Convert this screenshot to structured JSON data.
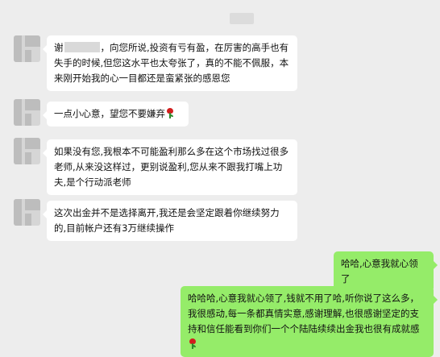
{
  "chat": {
    "messages": [
      {
        "side": "left",
        "parts": [
          "谢",
          "，向您所说,投资有亏有盈，在厉害的高手也有失手的时候,但您这水平也太夸张了，真的不能不佩服，本来刚开始我的心一目都还是蛮紧张的感恩您"
        ]
      },
      {
        "side": "left",
        "text": "一点小心意，望您不要嫌弃",
        "emoji": "rose-icon"
      },
      {
        "side": "left",
        "text": "如果没有您,我根本不可能盈利那么多在这个市场找过很多老师,从来没这样过，更别说盈利,您从来不跟我打嘴上功夫,是个行动派老师"
      },
      {
        "side": "left",
        "text": "这次出金并不是选择离开,我还是会坚定跟着你继续努力的,目前帐户还有3万继续操作"
      },
      {
        "side": "right",
        "text": "哈哈,心意我就心领了"
      },
      {
        "side": "right",
        "text": "哈哈哈,心意我就心领了,钱就不用了哈,听你说了这么多，我很感动,每一条都真情实意,感谢理解,也很感谢坚定的支持和信任能看到你们一个个陆陆续续出金我也很有成就感",
        "emoji": "rose-icon"
      }
    ]
  }
}
